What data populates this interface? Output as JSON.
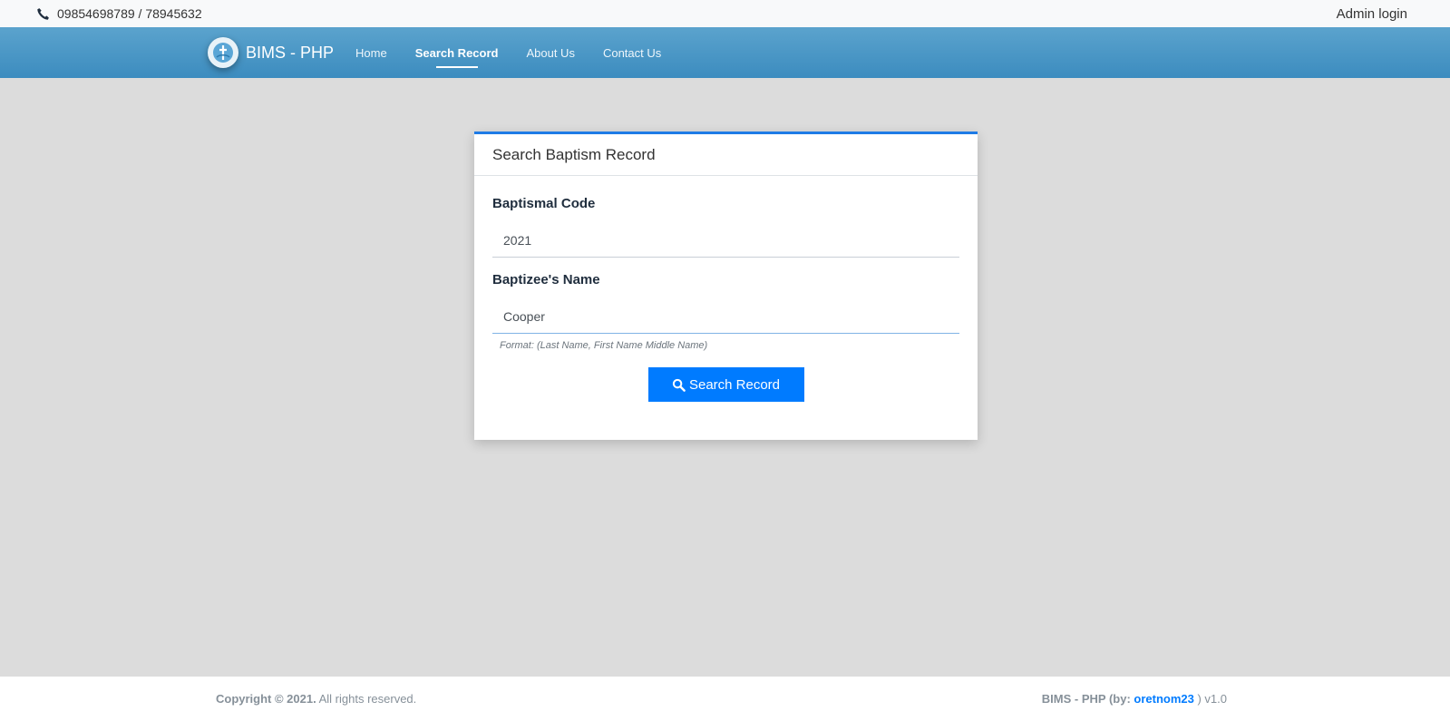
{
  "topbar": {
    "phone": "09854698789 / 78945632",
    "admin_login": "Admin login"
  },
  "navbar": {
    "brand": "BIMS - PHP",
    "links": [
      {
        "label": "Home",
        "active": false
      },
      {
        "label": "Search Record",
        "active": true
      },
      {
        "label": "About Us",
        "active": false
      },
      {
        "label": "Contact Us",
        "active": false
      }
    ]
  },
  "card": {
    "title": "Search Baptism Record",
    "fields": [
      {
        "label": "Baptismal Code",
        "value": "2021"
      },
      {
        "label": "Baptizee's Name",
        "value": "Cooper",
        "hint": "Format: (Last Name, First Name Middle Name)"
      }
    ],
    "button_label": "Search Record"
  },
  "footer": {
    "copyright_bold": "Copyright © 2021.",
    "copyright_rest": " All rights reserved.",
    "credit_prefix": "BIMS - PHP (by: ",
    "credit_author": "oretnom23",
    "credit_suffix": " ) v1.0"
  },
  "colors": {
    "accent": "#007bff",
    "navbar": "#4a98c8",
    "background": "#dcdcdc"
  },
  "icons": [
    "phone-icon",
    "church-logo-icon",
    "search-icon"
  ]
}
